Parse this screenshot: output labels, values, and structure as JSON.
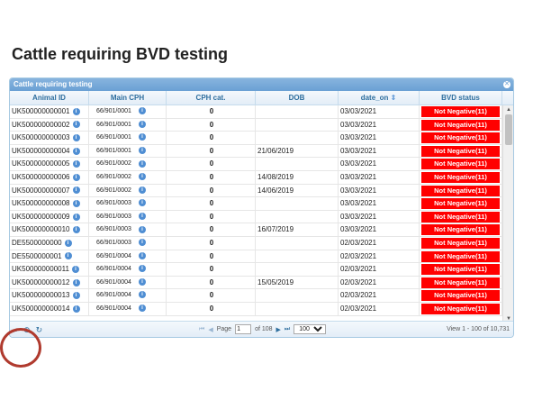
{
  "page": {
    "title": "Cattle requiring BVD testing"
  },
  "grid": {
    "caption": "Cattle requiring testing",
    "columns": [
      "Animal ID",
      "Main CPH",
      "CPH cat.",
      "DOB",
      "date_on",
      "BVD status"
    ],
    "sort_indicator": "⇕",
    "rows": [
      {
        "animal_id": "UK500000000001",
        "cph": "66/901/0001",
        "cat": "0",
        "dob": "",
        "date_on": "03/03/2021",
        "status": "Not Negative(11)"
      },
      {
        "animal_id": "UK500000000002",
        "cph": "66/901/0001",
        "cat": "0",
        "dob": "",
        "date_on": "03/03/2021",
        "status": "Not Negative(11)"
      },
      {
        "animal_id": "UK500000000003",
        "cph": "66/901/0001",
        "cat": "0",
        "dob": "",
        "date_on": "03/03/2021",
        "status": "Not Negative(11)"
      },
      {
        "animal_id": "UK500000000004",
        "cph": "66/901/0001",
        "cat": "0",
        "dob": "21/06/2019",
        "date_on": "03/03/2021",
        "status": "Not Negative(11)"
      },
      {
        "animal_id": "UK500000000005",
        "cph": "66/901/0002",
        "cat": "0",
        "dob": "",
        "date_on": "03/03/2021",
        "status": "Not Negative(11)"
      },
      {
        "animal_id": "UK500000000006",
        "cph": "66/901/0002",
        "cat": "0",
        "dob": "14/08/2019",
        "date_on": "03/03/2021",
        "status": "Not Negative(11)"
      },
      {
        "animal_id": "UK500000000007",
        "cph": "66/901/0002",
        "cat": "0",
        "dob": "14/06/2019",
        "date_on": "03/03/2021",
        "status": "Not Negative(11)"
      },
      {
        "animal_id": "UK500000000008",
        "cph": "66/901/0003",
        "cat": "0",
        "dob": "",
        "date_on": "03/03/2021",
        "status": "Not Negative(11)"
      },
      {
        "animal_id": "UK500000000009",
        "cph": "66/901/0003",
        "cat": "0",
        "dob": "",
        "date_on": "03/03/2021",
        "status": "Not Negative(11)"
      },
      {
        "animal_id": "UK500000000010",
        "cph": "66/901/0003",
        "cat": "0",
        "dob": "16/07/2019",
        "date_on": "03/03/2021",
        "status": "Not Negative(11)"
      },
      {
        "animal_id": "DE5500000000",
        "cph": "66/901/0003",
        "cat": "0",
        "dob": "",
        "date_on": "02/03/2021",
        "status": "Not Negative(11)"
      },
      {
        "animal_id": "DE5500000001",
        "cph": "66/901/0004",
        "cat": "0",
        "dob": "",
        "date_on": "02/03/2021",
        "status": "Not Negative(11)"
      },
      {
        "animal_id": "UK500000000011",
        "cph": "66/901/0004",
        "cat": "0",
        "dob": "",
        "date_on": "02/03/2021",
        "status": "Not Negative(11)"
      },
      {
        "animal_id": "UK500000000012",
        "cph": "66/901/0004",
        "cat": "0",
        "dob": "15/05/2019",
        "date_on": "02/03/2021",
        "status": "Not Negative(11)"
      },
      {
        "animal_id": "UK500000000013",
        "cph": "66/901/0004",
        "cat": "0",
        "dob": "",
        "date_on": "02/03/2021",
        "status": "Not Negative(11)"
      },
      {
        "animal_id": "UK500000000014",
        "cph": "66/901/0004",
        "cat": "0",
        "dob": "",
        "date_on": "02/03/2021",
        "status": "Not Negative(11)"
      }
    ]
  },
  "pager": {
    "page_label": "Page",
    "page_value": "1",
    "of_label": "of 108",
    "rows_per_page": "100",
    "view_text": "View 1 - 100 of 10,731"
  },
  "colors": {
    "status_red": "#ff0000",
    "header_blue": "#2e6e9e",
    "highlight_circle": "#b03a2e"
  },
  "icons": [
    "info-icon",
    "search-icon",
    "add-icon",
    "refresh-icon",
    "close-icon"
  ]
}
